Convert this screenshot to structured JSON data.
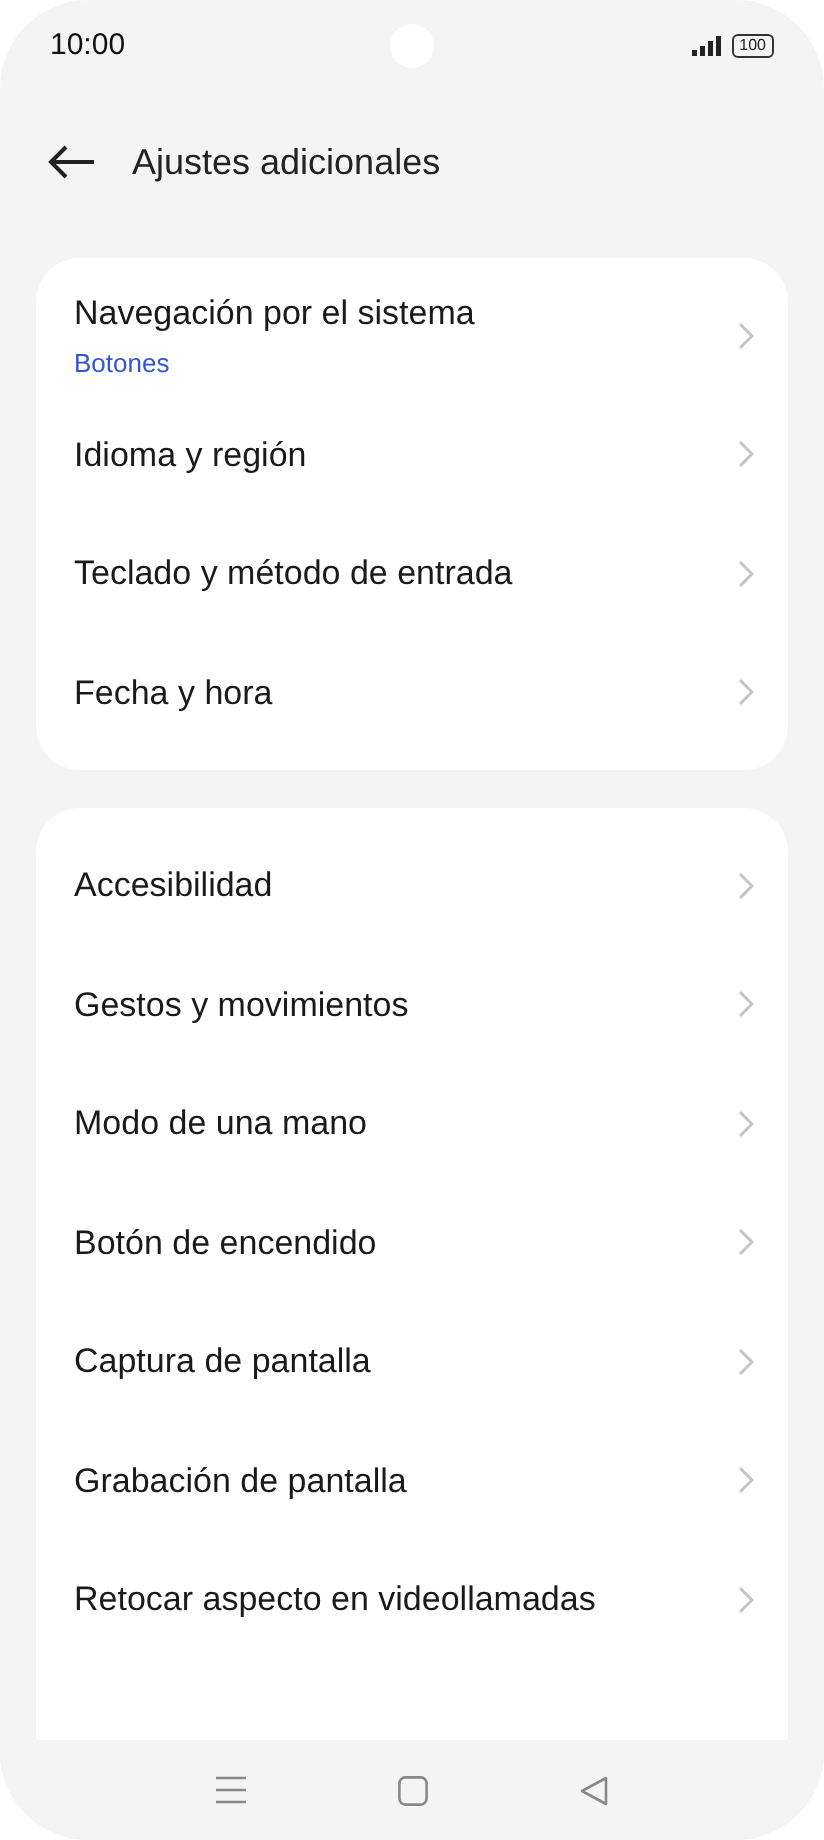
{
  "status_bar": {
    "time": "10:00",
    "battery": "100"
  },
  "header": {
    "title": "Ajustes adicionales"
  },
  "groups": [
    {
      "items": [
        {
          "label": "Navegación por el sistema",
          "value": "Botones"
        },
        {
          "label": "Idioma y región"
        },
        {
          "label": "Teclado y método de entrada"
        },
        {
          "label": "Fecha y hora"
        }
      ]
    },
    {
      "items": [
        {
          "label": "Accesibilidad"
        },
        {
          "label": "Gestos y movimientos"
        },
        {
          "label": "Modo de una mano"
        },
        {
          "label": "Botón de encendido"
        },
        {
          "label": "Captura de pantalla"
        },
        {
          "label": "Grabación de pantalla"
        },
        {
          "label": "Retocar aspecto en videollamadas"
        }
      ]
    }
  ]
}
